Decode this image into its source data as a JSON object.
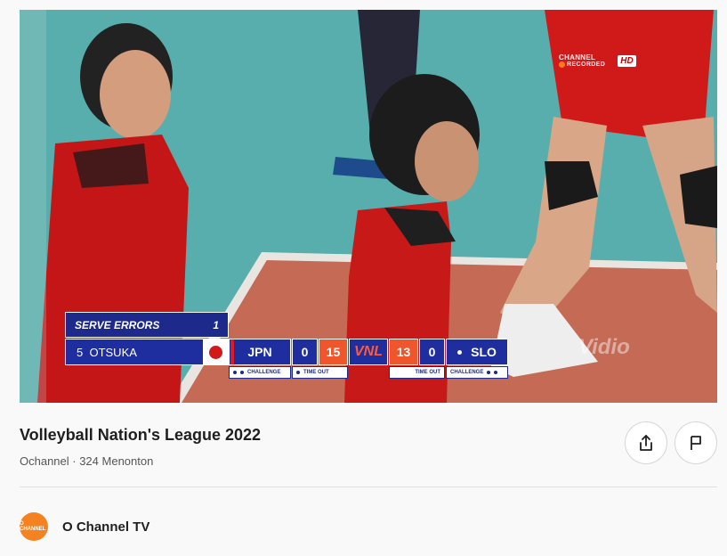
{
  "video": {
    "broadcaster": {
      "channel": "CHANNEL",
      "recorded_label": "RECORDED",
      "quality_badge": "HD"
    },
    "watermark": "Vidio",
    "scoreboard": {
      "stat_label": "SERVE ERRORS",
      "stat_value": "1",
      "player": "5  OTSUKA",
      "home_team": "JPN",
      "home_sets": "0",
      "home_points": "15",
      "league_logo": "VNL",
      "away_points": "13",
      "away_sets": "0",
      "away_team": "SLO",
      "challenge_label": "CHALLENGE",
      "timeout_label": "TIME OUT"
    }
  },
  "info": {
    "title": "Volleyball Nation's League 2022",
    "meta": "Ochannel · 324 Menonton",
    "share_icon": "share-icon",
    "report_icon": "flag-icon"
  },
  "channel": {
    "name": "O Channel TV",
    "avatar_text": "O CHANNEL"
  }
}
